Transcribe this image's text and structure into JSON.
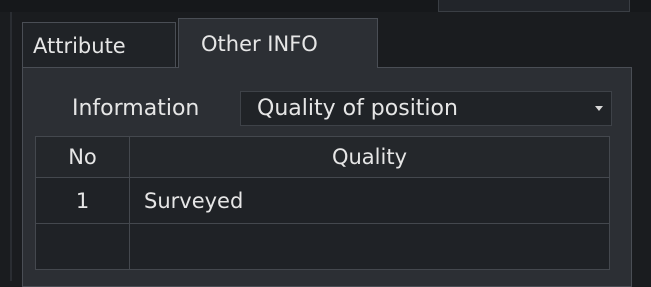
{
  "tabs": [
    {
      "label": "Attribute",
      "active": false
    },
    {
      "label": "Other INFO",
      "active": true
    }
  ],
  "information": {
    "label": "Information",
    "selected": "Quality of position"
  },
  "table": {
    "columns": [
      "No",
      "Quality"
    ],
    "rows": [
      {
        "no": "1",
        "quality": "Surveyed"
      },
      {
        "no": "",
        "quality": ""
      }
    ]
  }
}
